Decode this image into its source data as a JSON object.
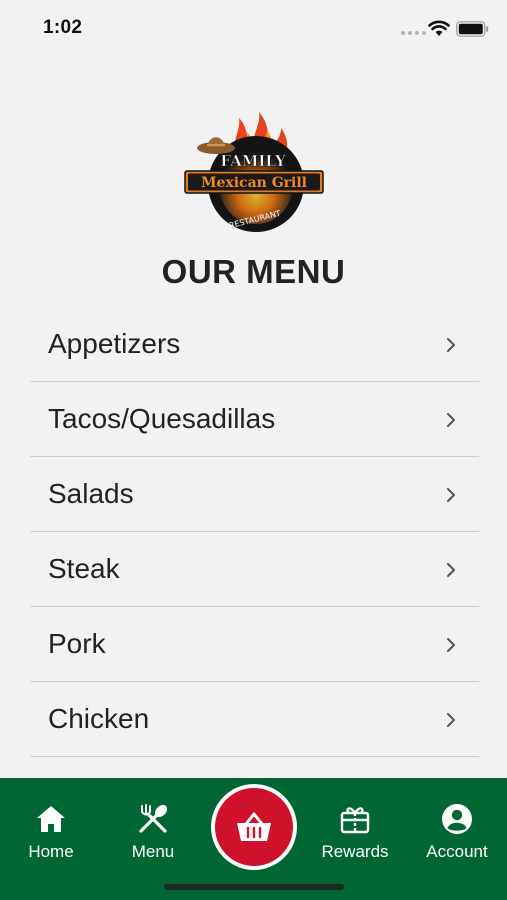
{
  "status_bar": {
    "time": "1:02"
  },
  "logo": {
    "line1": "FAMILY",
    "line2": "Mexican Grill",
    "line3": "RESTAURANT"
  },
  "page_title": "OUR MENU",
  "menu": {
    "items": [
      {
        "label": "Appetizers"
      },
      {
        "label": "Tacos/Quesadillas"
      },
      {
        "label": "Salads"
      },
      {
        "label": "Steak"
      },
      {
        "label": "Pork"
      },
      {
        "label": "Chicken"
      }
    ]
  },
  "tab_bar": {
    "home": {
      "label": "Home",
      "icon": "home-icon"
    },
    "menu": {
      "label": "Menu",
      "icon": "utensils-icon"
    },
    "cart": {
      "icon": "basket-icon"
    },
    "rewards": {
      "label": "Rewards",
      "icon": "gift-icon"
    },
    "account": {
      "label": "Account",
      "icon": "account-icon"
    }
  },
  "colors": {
    "background": "#f2f2f2",
    "tab_bar": "#006633",
    "cart_button": "#d0112b",
    "text": "#222222",
    "divider": "#cfcfcf"
  }
}
